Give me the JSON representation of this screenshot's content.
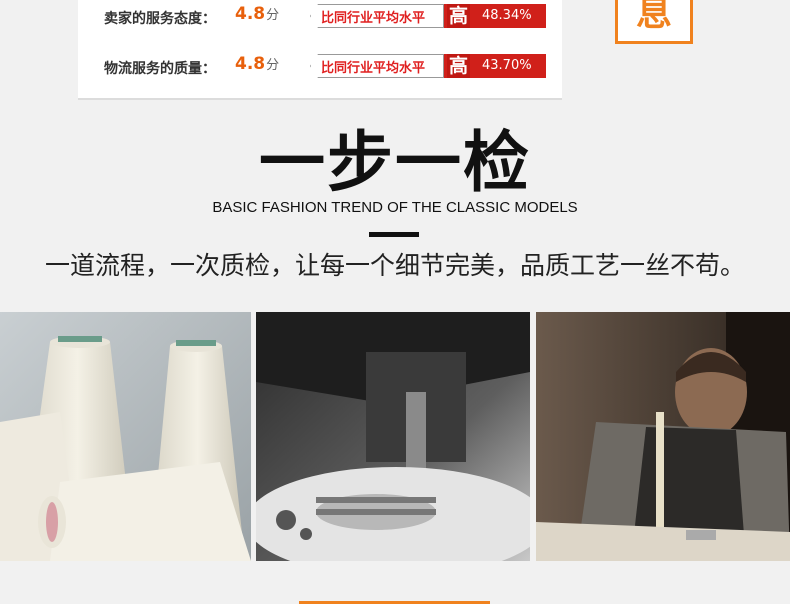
{
  "ratings": [
    {
      "label": "卖家的服务态度：",
      "score": "4.8",
      "unit": "分",
      "compare": "比同行业平均水平",
      "level": "高",
      "percent": "48.34%"
    },
    {
      "label": "物流服务的质量：",
      "score": "4.8",
      "unit": "分",
      "compare": "比同行业平均水平",
      "level": "高",
      "percent": "43.70%"
    }
  ],
  "badge": {
    "char": "息"
  },
  "section": {
    "title": "一步一检",
    "subtitle": "BASIC FASHION TREND OF THE CLASSIC MODELS",
    "slogan": "一道流程，一次质检，让每一个细节完美，品质工艺一丝不苟。"
  },
  "colors": {
    "accent": "#f0821e",
    "high_red": "#d0201a",
    "score_orange": "#e8600c"
  }
}
